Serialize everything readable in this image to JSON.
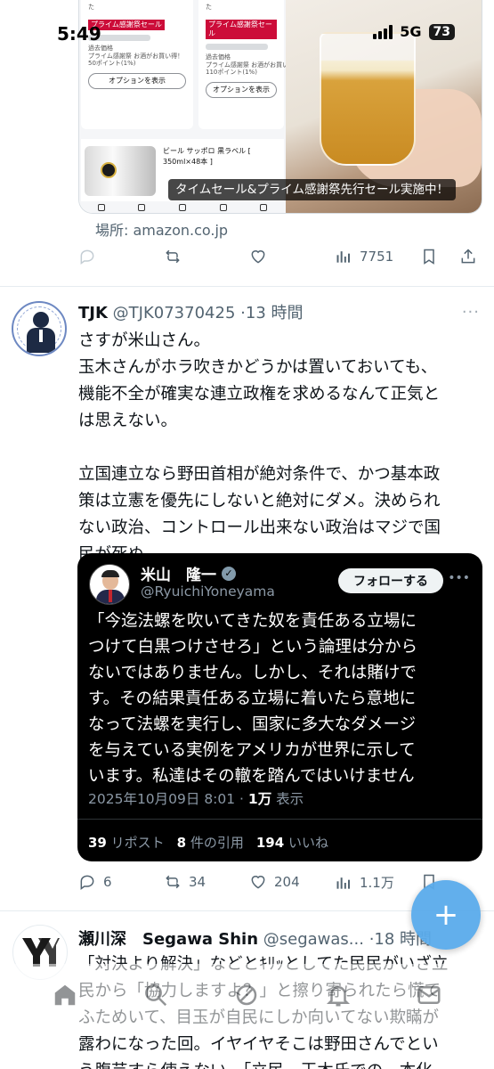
{
  "status_bar": {
    "time": "5:49",
    "network": "5G",
    "battery": "73"
  },
  "prev_tweet": {
    "shop": {
      "badge1": "プライム感謝祭セール",
      "badge2": "プライム感謝祭セール",
      "col1_top": "た",
      "col2_top": "た",
      "past_price_label": "過去価格",
      "col1_line": "プライム感謝祭 お酒がお買い得！",
      "col1_points": "50ポイント(1%)",
      "col2_line": "プライム感謝祭 お酒がお買い得！",
      "col2_points": "110ポイント(1%)",
      "option_button": "オプションを表示",
      "beer_title": "ビール サッポロ 黒ラベル [",
      "beer_sub": "350ml×48本 ]"
    },
    "caption": "タイムセール&プライム感謝祭先行セール実施中！",
    "location": "場所: amazon.co.jp",
    "views": "7751"
  },
  "tweet": {
    "name": "TJK",
    "handle": "@TJK07370425",
    "time": "·13 時間",
    "more": "···",
    "text": "さすが米山さん。\n玉木さんがホラ吹きかどうかは置いておいても、\n機能不全が確実な連立政権を求めるなんて正気と\nは思えない。\n\n立国連立なら野田首相が絶対条件で、かつ基本政\n策は立憲を優先にしないと絶対にダメ。決められ\nない政治、コントロール出来ない政治はマジで国\n民が死ぬ。",
    "quote": {
      "name": "米山　隆一",
      "handle": "@RyuichiYoneyama",
      "follow": "フォローする",
      "more": "•••",
      "text": "「今迄法螺を吹いてきた奴を責任ある立場に\nつけて白黒つけさせろ」という論理は分から\nないではありません。しかし、それは賭けで\nす。その結果責任ある立場に着いたら意地に\nなって法螺を実行し、国家に多大なダメージ\nを与えている実例をアメリカが世界に示して\nいます。私達はその轍を踏んではいけません",
      "date": "2025年10月09日 8:01 · ",
      "views_num": "1万",
      "views_label": " 表示",
      "reposts_num": "39",
      "reposts_label": " リポスト",
      "quotes_num": "8",
      "quotes_label": " 件の引用",
      "likes_num": "194",
      "likes_label": " いいね"
    },
    "replies": "6",
    "retweets": "34",
    "likes": "204",
    "views": "1.1万"
  },
  "next_tweet": {
    "name": "瀬川深　Segawa Shin",
    "handle": "@segawas...",
    "time": "·18 時間",
    "text": "「対決より解決」などとｷﾘｯとしてた民民がいざ立\n民から「協力しますよ？」と擦り寄られたら慌て\nふためいて、目玉が自民にしか向いてない欺瞞が\n露わになった回。イヤイヤそこは野田さんでとい\nう腹芸すら使えない。「立民、玉木氏での一本化"
  },
  "fab": "+",
  "colors": {
    "accent": "#1d9bf0",
    "muted": "#536471",
    "quote_bg": "#000000"
  }
}
